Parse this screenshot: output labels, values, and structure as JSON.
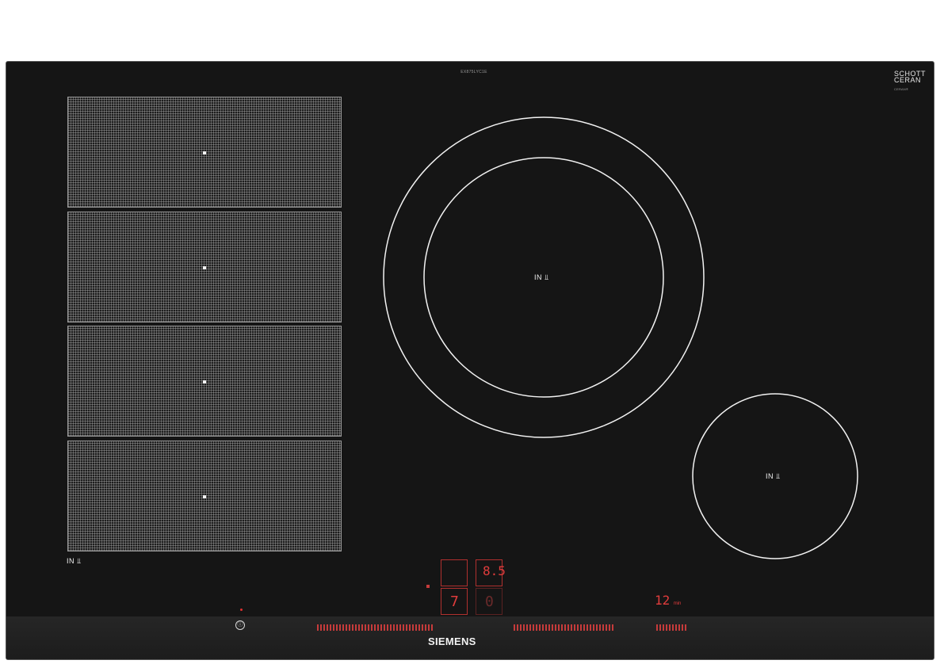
{
  "hob": {
    "model_code": "EX875LYC1E",
    "schott_line1": "SCHOTT",
    "schott_line2": "CERAN",
    "schott_small": "CERAN®",
    "brand": "SIEMENS",
    "induction_label": "IN",
    "pot_symbol": "⫫",
    "power_symbol": "ⓘ",
    "flex_zone_count": 4,
    "display": {
      "top_right_digit": "8.5",
      "bottom_left_digit": "7",
      "bottom_right_digit": "0",
      "timer_value": "12",
      "timer_unit": "min"
    },
    "colors": {
      "glass": "#151515",
      "zone_line": "#f2f2f2",
      "indicator_red": "#e03c3c"
    }
  }
}
